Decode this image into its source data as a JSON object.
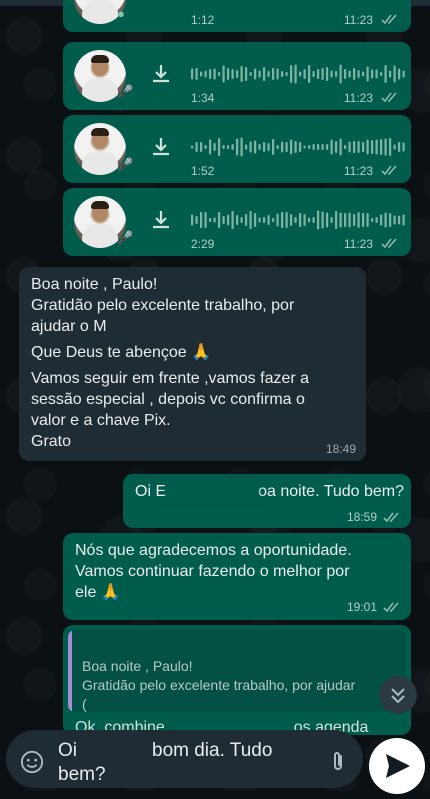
{
  "voice_messages": [
    {
      "duration": "1:12",
      "time": "11:23"
    },
    {
      "duration": "1:34",
      "time": "11:23"
    },
    {
      "duration": "1:52",
      "time": "11:23"
    },
    {
      "duration": "2:29",
      "time": "11:23"
    }
  ],
  "incoming": {
    "lines": [
      "Boa noite , Paulo!",
      "Gratidão pelo excelente trabalho, por",
      "ajudar o M",
      "Que Deus te abençoe  🙏",
      "Vamos seguir em frente ,vamos fazer a",
      "sessão especial , depois vc confirma o",
      "valor e a chave Pix.",
      "Grato"
    ],
    "time": "18:49"
  },
  "outgoing_1": {
    "prefix": "Oi E",
    "suffix": "oa noite. Tudo bem?",
    "time": "18:59"
  },
  "outgoing_2": {
    "lines": [
      "Nós que agradecemos a oportunidade.",
      "Vamos continuar fazendo o melhor por",
      "ele 🙏"
    ],
    "time": "19:01"
  },
  "quoted_reply": {
    "quote_line1": "Boa noite , Paulo!",
    "quote_line2": "Gratidão pelo excelente trabalho, por ajudar",
    "reply_partial_start": "Ok, combine",
    "reply_partial_end": "os agenda"
  },
  "composer": {
    "text_start": "Oi",
    "text_end": "bom dia. Tudo",
    "text_line2": "bem?"
  },
  "colors": {
    "outgoing_bubble": "#005c4b",
    "incoming_bubble": "#202c33",
    "background": "#0b1014",
    "read_ticks": "#8fb8ad"
  }
}
